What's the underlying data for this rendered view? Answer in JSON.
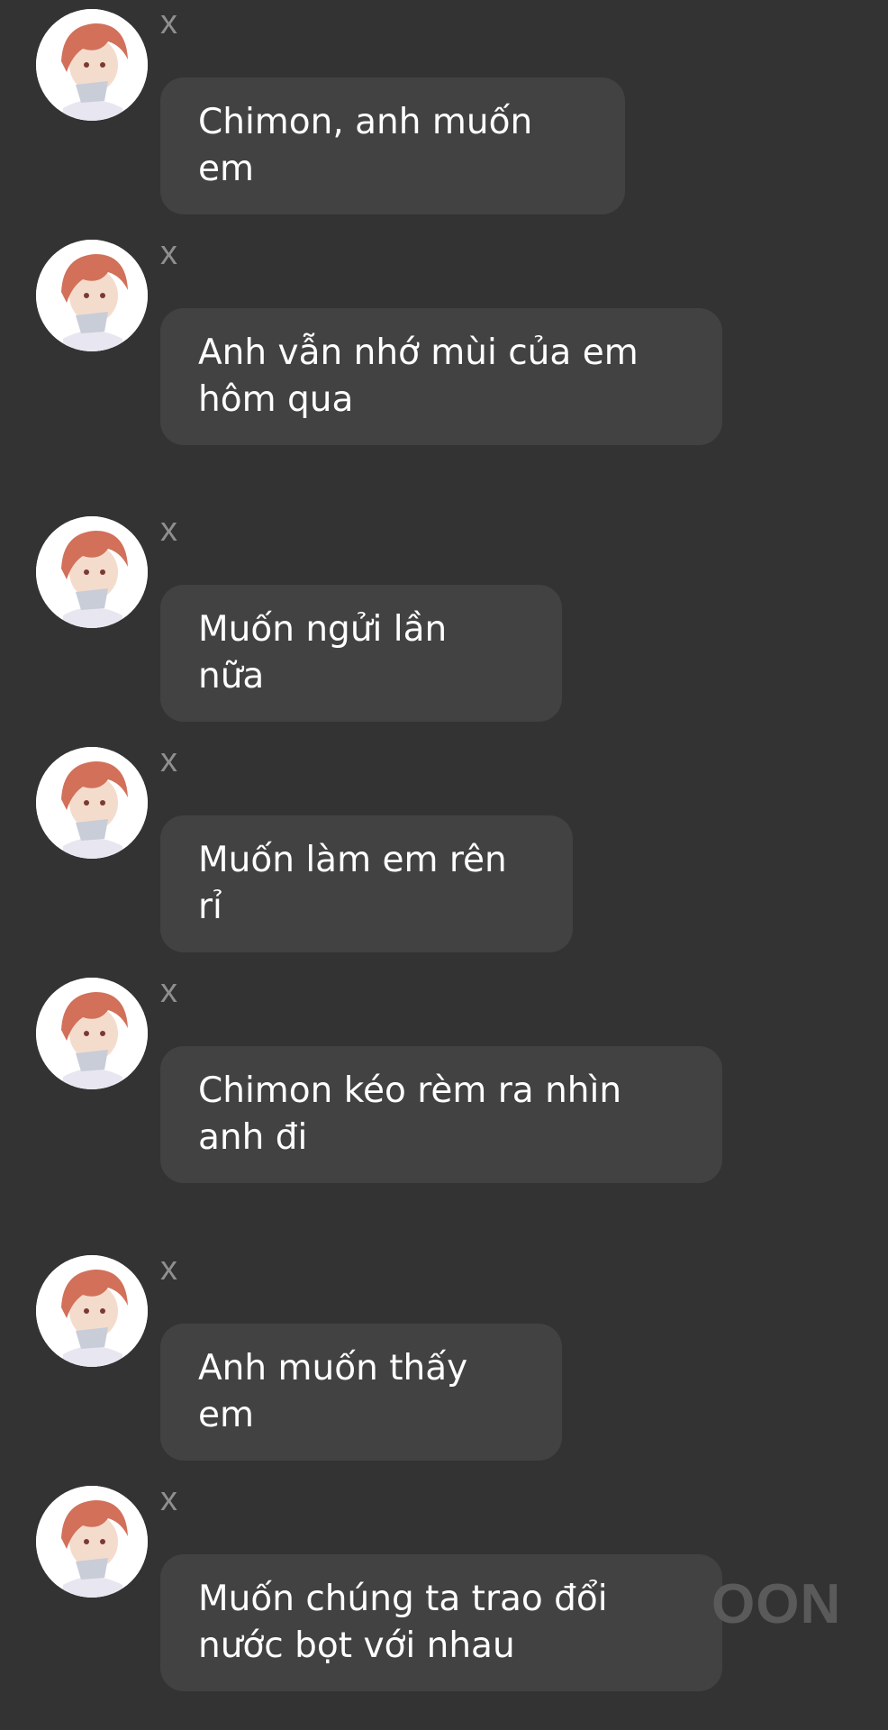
{
  "colors": {
    "background": "#333333",
    "bubble": "#424242",
    "text": "#ffffff",
    "sender": "#8f8f8f",
    "avatar_hair": "#d2705a",
    "avatar_ring": "#ffffff"
  },
  "avatar_icon": "anime-boy-avatar",
  "watermark": "OON",
  "messages": [
    {
      "sender": "x",
      "text": "Chimon, anh muốn em"
    },
    {
      "sender": "x",
      "text": "Anh vẫn nhớ mùi của em hôm qua"
    },
    {
      "sender": "x",
      "text": "Muốn ngửi lần nữa"
    },
    {
      "sender": "x",
      "text": "Muốn làm em rên rỉ"
    },
    {
      "sender": "x",
      "text": "Chimon kéo rèm ra nhìn anh đi"
    },
    {
      "sender": "x",
      "text": "Anh muốn thấy em"
    },
    {
      "sender": "x",
      "text": "Muốn chúng ta trao đổi nước bọt với nhau"
    }
  ]
}
